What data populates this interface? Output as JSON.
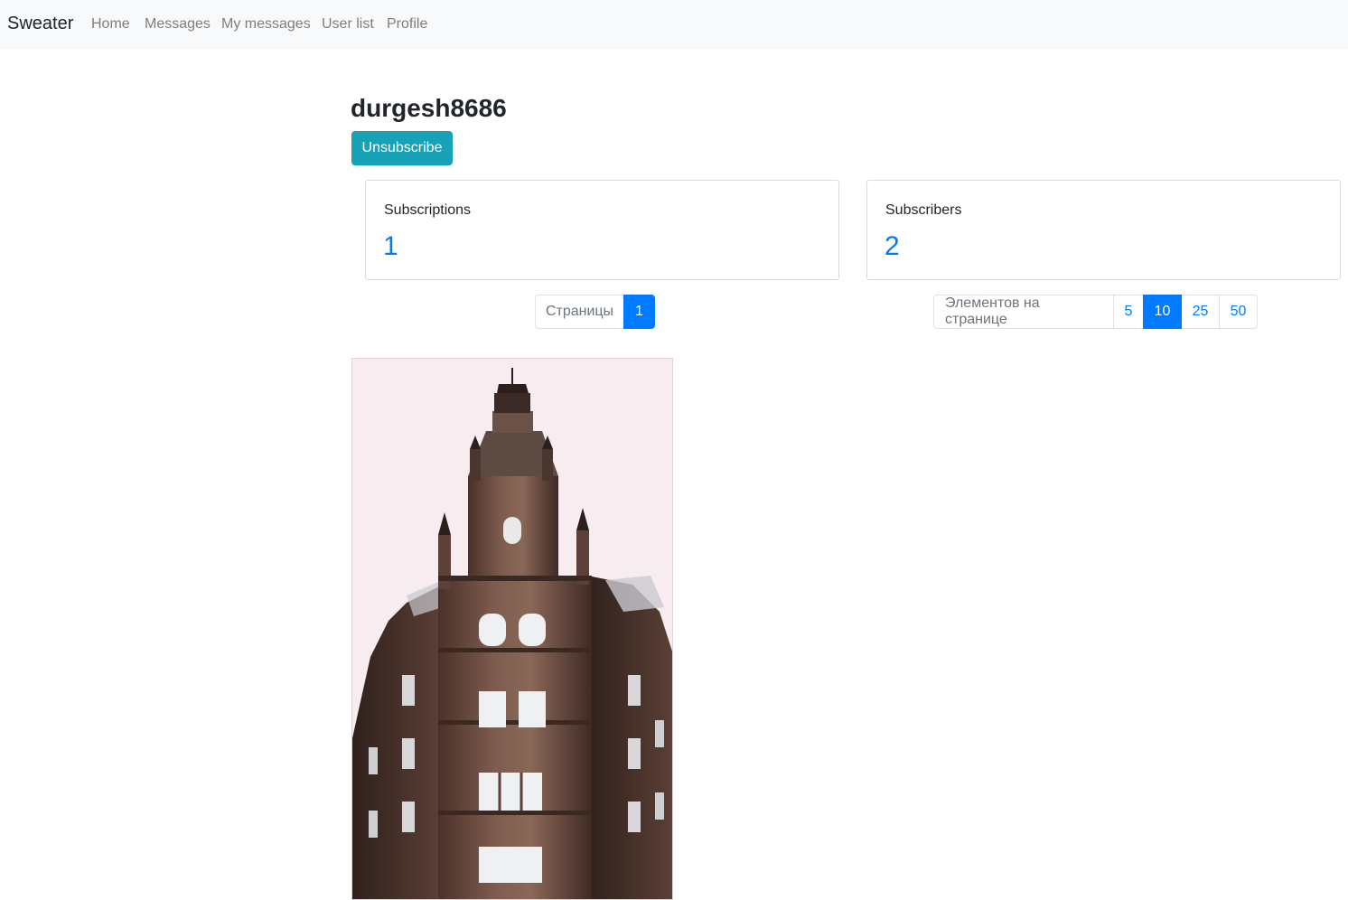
{
  "navbar": {
    "brand": "Sweater",
    "links": [
      "Home",
      "Messages",
      "My messages",
      "User list",
      "Profile"
    ]
  },
  "profile": {
    "username": "durgesh8686",
    "unsubscribe_label": "Unsubscribe",
    "subscriptions": {
      "label": "Subscriptions",
      "count": "1"
    },
    "subscribers": {
      "label": "Subscribers",
      "count": "2"
    }
  },
  "pagination": {
    "pages_label": "Страницы",
    "pages": [
      "1"
    ],
    "active_page": "1",
    "per_page_label": "Элементов на странице",
    "per_page_options": [
      "5",
      "10",
      "25",
      "50"
    ],
    "active_per_page": "10"
  },
  "colors": {
    "primary": "#007bff",
    "info": "#17a2b8",
    "navbar_bg": "#f8f9fa",
    "photo_bg": "#f7ecef"
  },
  "message_image": {
    "icon": "building-photo"
  }
}
